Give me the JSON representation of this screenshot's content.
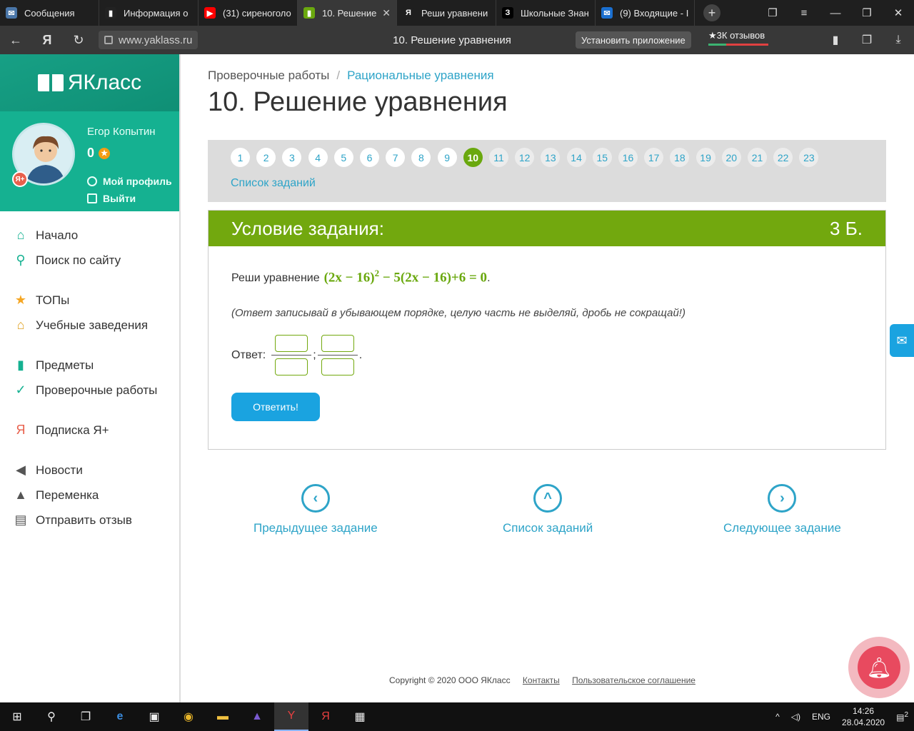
{
  "browser": {
    "tabs": [
      {
        "title": "Сообщения",
        "color": "#4a76a8",
        "glyph": "✉"
      },
      {
        "title": "Информация о",
        "color": "#222",
        "glyph": "▮"
      },
      {
        "title": "(31) сиреноголо",
        "color": "#ff0000",
        "glyph": "▶"
      },
      {
        "title": "10. Решение",
        "color": "#6aa80e",
        "glyph": "▮",
        "active": true,
        "close": "✕"
      },
      {
        "title": "Реши уравнени",
        "color": "#1f1f1f",
        "glyph": "Я"
      },
      {
        "title": "Школьные Знан",
        "color": "#000",
        "glyph": "З"
      },
      {
        "title": "(9) Входящие - I",
        "color": "#1a6fd0",
        "glyph": "✉"
      }
    ],
    "new_tab": "+",
    "url": "www.yaklass.ru",
    "page_title": "10. Решение уравнения",
    "install_label": "Установить приложение",
    "reviews_label": "★3К отзывов"
  },
  "sidebar": {
    "logo": "ЯКласс",
    "user_name": "Егор Копытин",
    "points": "0",
    "profile_link": "Мой профиль",
    "logout_link": "Выйти",
    "menu": [
      {
        "label": "Начало",
        "icon": "⌂",
        "color": "#15b191",
        "name": "home"
      },
      {
        "label": "Поиск по сайту",
        "icon": "⚲",
        "color": "#15b191",
        "name": "search"
      },
      {
        "label": "ТОПы",
        "icon": "★",
        "color": "#f5a623",
        "name": "tops"
      },
      {
        "label": "Учебные заведения",
        "icon": "⌂",
        "color": "#e0a020",
        "name": "schools"
      },
      {
        "label": "Предметы",
        "icon": "▮",
        "color": "#15b191",
        "name": "subjects"
      },
      {
        "label": "Проверочные работы",
        "icon": "✓",
        "color": "#15b191",
        "name": "tests"
      },
      {
        "label": "Подписка Я+",
        "icon": "Я",
        "color": "#e8604c",
        "name": "subscription"
      },
      {
        "label": "Новости",
        "icon": "◀",
        "color": "#555",
        "name": "news"
      },
      {
        "label": "Переменка",
        "icon": "▲",
        "color": "#555",
        "name": "break"
      },
      {
        "label": "Отправить отзыв",
        "icon": "▤",
        "color": "#555",
        "name": "feedback"
      }
    ]
  },
  "main": {
    "breadcrumb_root": "Проверочные работы",
    "breadcrumb_sep": "/",
    "breadcrumb_current": "Рациональные уравнения",
    "title": "10. Решение уравнения",
    "pager": {
      "pages": [
        "1",
        "2",
        "3",
        "4",
        "5",
        "6",
        "7",
        "8",
        "9",
        "10",
        "11",
        "12",
        "13",
        "14",
        "15",
        "16",
        "17",
        "18",
        "19",
        "20",
        "21",
        "22",
        "23"
      ],
      "active": 10,
      "task_list_link": "Список заданий"
    },
    "task": {
      "header": "Условие задания:",
      "points": "3 Б.",
      "prompt": "Реши уравнение",
      "equation_base": "(2x − 16)",
      "equation_exp": "2",
      "equation_rest": "− 5(2x − 16)+6 = 0",
      "equation_end": ".",
      "hint": "(Ответ записывай в убывающем порядке, целую часть не выделяй, дробь не сокращай!)",
      "answer_label": "Ответ:",
      "separator": ";",
      "period": ".",
      "submit": "Ответить!"
    },
    "nav": {
      "prev": "Предыдущее задание",
      "list": "Список заданий",
      "next": "Следующее задание"
    },
    "footer": {
      "copyright": "Copyright © 2020 ООО ЯКласс",
      "contacts": "Контакты",
      "agreement": "Пользовательское соглашение"
    }
  },
  "taskbar": {
    "lang": "ENG",
    "time": "14:26",
    "date": "28.04.2020",
    "notifications": "2"
  }
}
